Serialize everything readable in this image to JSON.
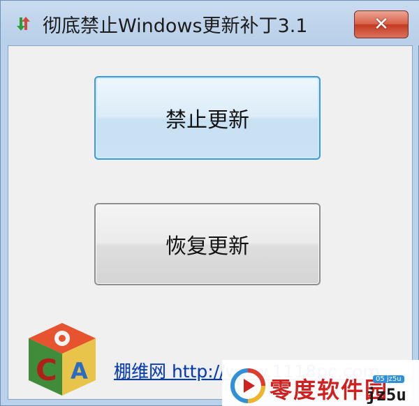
{
  "window": {
    "title": "彻底禁止Windows更新补丁3.1",
    "close_glyph": "✕"
  },
  "buttons": {
    "disable_label": "禁止更新",
    "restore_label": "恢复更新"
  },
  "footer": {
    "link_text": "棚维网 http://www.1118pc.com",
    "logo": "cube-logo"
  },
  "watermark": {
    "text": "零度软件园",
    "brand": "jz5u",
    "tag": "05 jz5u"
  },
  "colors": {
    "close_button": "#c43a22",
    "primary_border": "#3c9ad8",
    "link": "#0b3aa8"
  }
}
